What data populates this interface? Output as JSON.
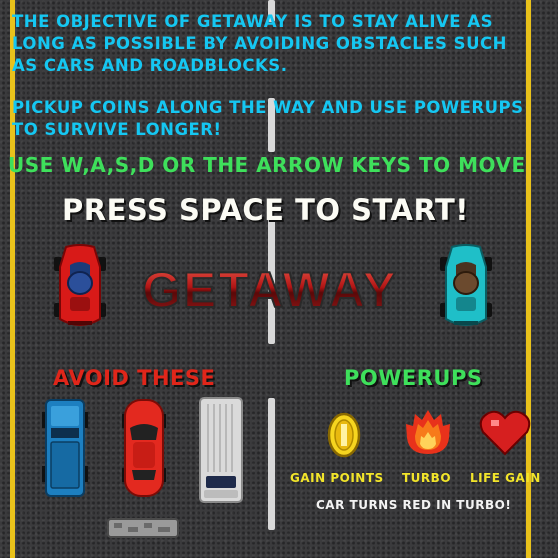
{
  "intro": {
    "line1": "THE OBJECTIVE OF GETAWAY IS TO STAY ALIVE AS",
    "line2": "LONG AS POSSIBLE BY AVOIDING OBSTACLES SUCH",
    "line3": "AS CARS AND ROADBLOCKS.",
    "line4": "PICKUP COINS ALONG THE WAY AND USE POWERUPS",
    "line5": "TO SURVIVE LONGER!"
  },
  "controls": "USE W,A,S,D OR THE ARROW KEYS TO MOVE",
  "start_prompt": "PRESS SPACE TO START!",
  "logo_text": "GETAWAY",
  "avoid": {
    "title": "AVOID THESE"
  },
  "powerups": {
    "title": "POWERUPS",
    "items": [
      {
        "icon": "coin-icon",
        "label": "GAIN POINTS"
      },
      {
        "icon": "flame-icon",
        "label": "TURBO"
      },
      {
        "icon": "heart-icon",
        "label": "LIFE GAIN"
      }
    ],
    "note": "CAR TURNS RED IN TURBO!"
  },
  "colors": {
    "road": "#3b3b3d",
    "edge_line": "#e9c21b",
    "blue_text": "#15c7f2",
    "green_text": "#3ee05b",
    "avoid_red": "#e0261a",
    "yellow_label": "#f2e52a"
  }
}
